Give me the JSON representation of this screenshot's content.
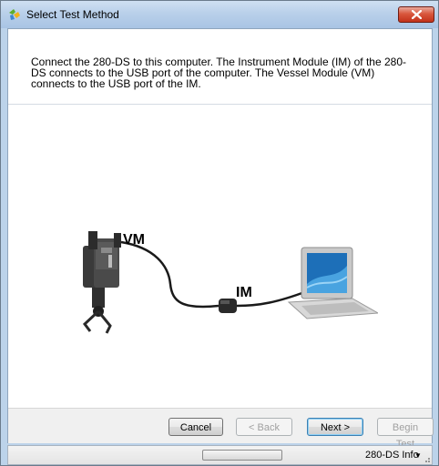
{
  "window": {
    "title": "Select Test Method"
  },
  "instructions": "Connect the 280-DS to this computer. The Instrument Module (IM) of the 280-DS connects to the USB port of the computer. The Vessel Module (VM) connects to the USB port of the IM.",
  "diagram": {
    "vm_label": "VM",
    "im_label": "IM"
  },
  "buttons": {
    "cancel": "Cancel",
    "back": "< Back",
    "next": "Next >",
    "begin_test": "Begin Test"
  },
  "statusbar": {
    "info": "280-DS Info",
    "info_arrow": "▼"
  },
  "icons": {
    "app": "app-icon",
    "close": "close-icon",
    "dropdown": "dropdown-arrow-icon",
    "grip": "resize-grip-icon"
  },
  "colors": {
    "title_bg": "#b9d0ea",
    "close_button": "#c2321a",
    "default_button_border": "#3c7fb1"
  }
}
